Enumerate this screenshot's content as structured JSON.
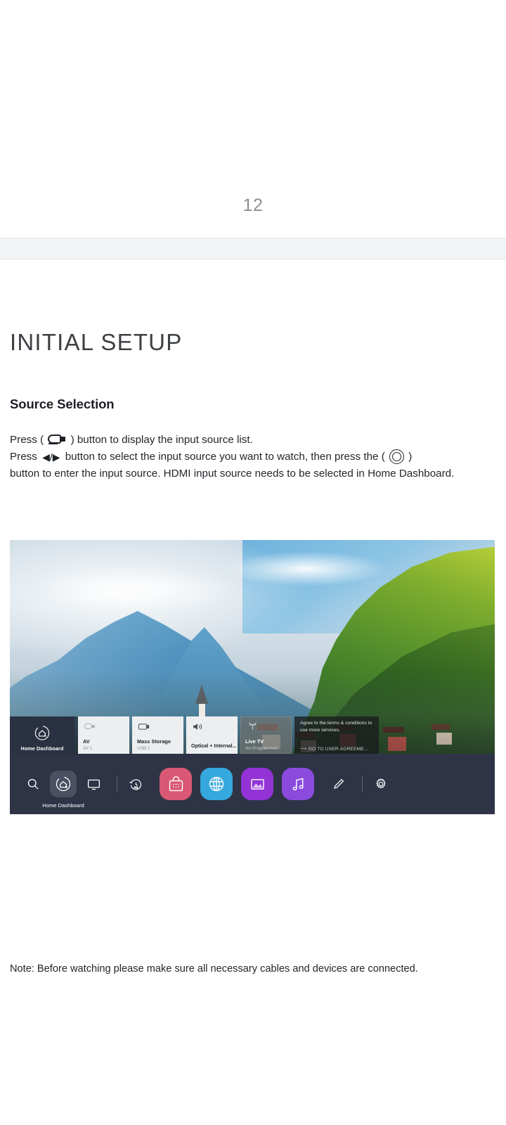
{
  "page": {
    "number": "12"
  },
  "heading": {
    "section_title": "INITIAL SETUP",
    "sub_title": "Source Selection"
  },
  "instructions": {
    "line1_before": "Press (",
    "line1_after": ") button to display the input source list.",
    "line2_before": "Press",
    "line2_arrows": "◀/▶",
    "line2_mid": "button to select the input source you want to watch, then press the (",
    "line2_after": ")",
    "line3": "button to enter the input source. HDMI input source needs to be selected in Home Dashboard.",
    "input_icon_name": "input-source-icon",
    "ok_icon_name": "ok-button-icon"
  },
  "tv_screenshot": {
    "home_card": {
      "label": "Home Dashboard",
      "icon": "home-dashboard-icon"
    },
    "sources": [
      {
        "title": "AV",
        "sub": "AV 1",
        "icon": "av-input-icon"
      },
      {
        "title": "Mass Storage",
        "sub": "USB 1",
        "icon": "usb-storage-icon"
      },
      {
        "title": "Optical + Internal...",
        "sub": "",
        "icon": "optical-audio-icon"
      },
      {
        "title": "Live TV",
        "sub": "No Programmes",
        "icon": "antenna-icon"
      }
    ],
    "agreement": {
      "text": "Agree to the terms & conditions to use more services.",
      "link": "GO TO USER AGREEME...",
      "link_icon": "external-link-arrow-icon"
    },
    "launcher": {
      "active_label": "Home Dashboard",
      "icons": [
        {
          "name": "search-icon"
        },
        {
          "name": "home-dashboard-icon"
        },
        {
          "name": "display-monitor-icon"
        },
        {
          "name": "time-machine-icon"
        }
      ],
      "tiles": [
        {
          "name": "content-store-icon",
          "color": "#d95873"
        },
        {
          "name": "web-browser-icon",
          "color": "#35a8dd"
        },
        {
          "name": "photo-gallery-icon",
          "color": "#9333d6"
        },
        {
          "name": "music-player-icon",
          "color": "#8a4bdc"
        }
      ],
      "right_icons": [
        {
          "name": "edit-pencil-icon"
        },
        {
          "name": "settings-gear-icon"
        }
      ]
    }
  },
  "footer": {
    "note": "Note: Before watching please make sure all necessary cables and devices are connected."
  },
  "colors": {
    "page_number": "#8d8f93",
    "band": "#f1f3f5",
    "launcher_bg": "#2e3446",
    "home_card_bg": "#2a3142",
    "card_bg": "#eceef0"
  }
}
